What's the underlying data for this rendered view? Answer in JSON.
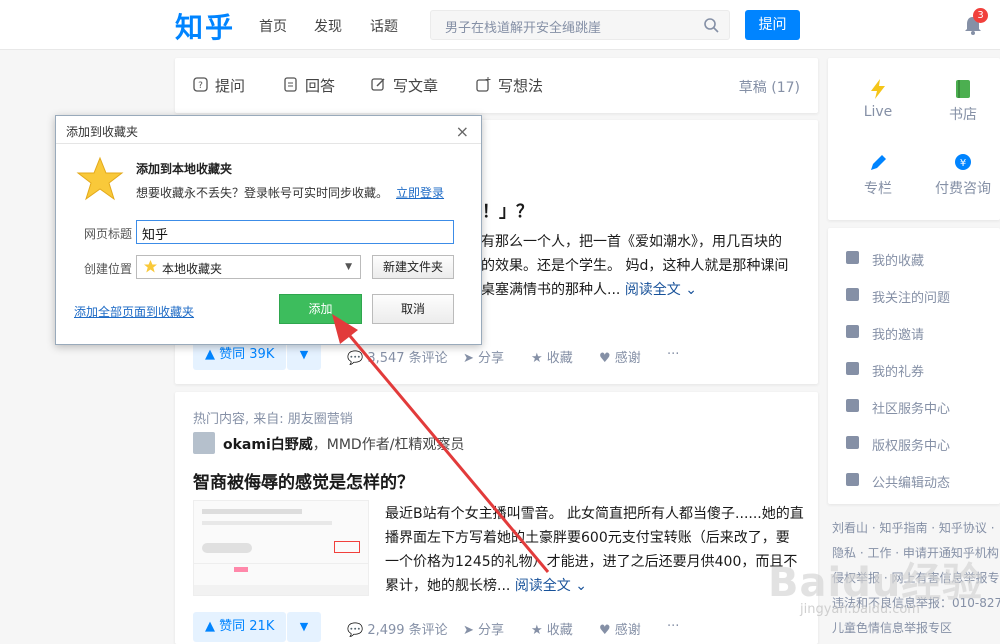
{
  "header": {
    "logo": "知乎",
    "nav": [
      "首页",
      "发现",
      "话题"
    ],
    "search_placeholder": "男子在栈道解开安全绳跳崖",
    "ask_label": "提问",
    "notification_count": "3"
  },
  "writebar": {
    "items": [
      "提问",
      "回答",
      "写文章",
      "写想法"
    ],
    "draft": "草稿 (17)"
  },
  "feed1": {
    "title_partial": "法！」？",
    "excerpt_lines": [
      "有那么一个人，把一首《爱如潮水》，用几百块的",
      "的效果。还是个学生。 妈d，这种人就是那种课间",
      "桌塞满情书的那种人..."
    ],
    "read_more": "阅读全文",
    "vote": "赞同 39K",
    "comments": "3,547 条评论",
    "share": "分享",
    "collect": "收藏",
    "thanks": "感谢",
    "more": "···"
  },
  "feed2": {
    "meta": "热门内容, 来自: 朋友圈营销",
    "author_name": "okami白野威",
    "author_bio": "，MMD作者/杠精观察员",
    "title": "智商被侮辱的感觉是怎样的？",
    "excerpt_lines": [
      "最近B站有个女主播叫雪音。 此女简直把所有人都当傻子......她的直",
      "播界面左下方写着她的土豪胖要600元支付宝转账（后来改了，要",
      "一个价格为1245的礼物）才能进，进了之后还要月供400，而且不",
      "累计，她的舰长榜..."
    ],
    "read_more": "阅读全文",
    "vote": "赞同 21K",
    "comments": "2,499 条评论",
    "share": "分享",
    "collect": "收藏",
    "thanks": "感谢",
    "more": "···"
  },
  "sidebar": {
    "grid": [
      {
        "label": "Live",
        "icon": "lightning-icon",
        "color": "#f5c518"
      },
      {
        "label": "书店",
        "icon": "book-icon",
        "color": "#4caf50"
      },
      {
        "label": "专栏",
        "icon": "pen-icon",
        "color": "#0084ff"
      },
      {
        "label": "付费咨询",
        "icon": "consult-icon",
        "color": "#0084ff"
      }
    ],
    "list": [
      "我的收藏",
      "我关注的问题",
      "我的邀请",
      "我的礼券",
      "社区服务中心",
      "版权服务中心",
      "公共编辑动态"
    ],
    "footer_lines": [
      "刘看山 · 知乎指南 · 知乎协议 ·",
      "隐私 · 工作 · 申请开通知乎机构",
      "侵权举报 · 网上有害信息举报专",
      "违法和不良信息举报：010-827",
      "儿童色情信息举报专区"
    ]
  },
  "dialog": {
    "title": "添加到收藏夹",
    "close": "×",
    "heading": "添加到本地收藏夹",
    "sub_text": "想要收藏永不丢失？登录帐号可实时同步收藏。",
    "login_link": "立即登录",
    "page_title_label": "网页标题",
    "page_title_value": "知乎",
    "location_label": "创建位置",
    "location_value": "本地收藏夹",
    "new_folder": "新建文件夹",
    "add_all": "添加全部页面到收藏夹",
    "add": "添加",
    "cancel": "取消"
  },
  "watermark": {
    "main": "Baidu经验",
    "sub": "jingyan.baidu.com"
  }
}
